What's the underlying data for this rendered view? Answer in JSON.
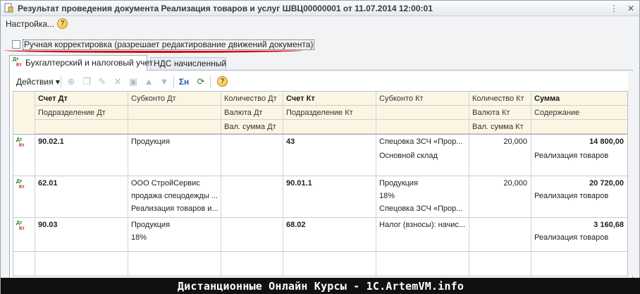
{
  "window": {
    "title": "Результат проведения документа Реализация товаров и услуг ШВЦ00000001 от 11.07.2014 12:00:01",
    "icon": "document-icon"
  },
  "menu": {
    "settings_label": "Настройка...",
    "help_label": "?"
  },
  "manual_edit": {
    "label": "Ручная корректировка (разрешает редактирование движений документа)",
    "checked": false
  },
  "tabs": [
    {
      "label": "Бухгалтерский и налоговый учет",
      "active": true,
      "icon_top": "Дт",
      "icon_bottom": "Кт"
    },
    {
      "label": "НДС начисленный",
      "active": false
    }
  ],
  "toolbar": {
    "actions_label": "Действия",
    "sum_label": "Σн",
    "help_label": "?"
  },
  "columns": {
    "row1": [
      "Счет Дт",
      "Субконто Дт",
      "Количество Дт",
      "Счет Кт",
      "Субконто Кт",
      "Количество Кт",
      "Сумма"
    ],
    "row2": [
      "Подразделение Дт",
      "",
      "Валюта Дт",
      "Подразделение Кт",
      "",
      "Валюта Кт",
      "Содержание"
    ],
    "row3": [
      "",
      "",
      "Вал. сумма Дт",
      "",
      "",
      "Вал. сумма Кт",
      ""
    ]
  },
  "rows": [
    {
      "icon_top": "Дт",
      "icon_bottom": "Кт",
      "acct_dt": "90.02.1",
      "sub_dt": [
        "Продукция"
      ],
      "qty_dt": "",
      "acct_kt": "43",
      "sub_kt": [
        "Спецовка ЗСЧ «Прор...",
        "Основной склад"
      ],
      "qty_kt": "20,000",
      "sum": "14 800,00",
      "content": "Реализация товаров"
    },
    {
      "icon_top": "Дт",
      "icon_bottom": "Кт",
      "acct_dt": "62.01",
      "sub_dt": [
        "ООО СтройСервис",
        "продажа спецодежды ...",
        "Реализация товаров и..."
      ],
      "qty_dt": "",
      "acct_kt": "90.01.1",
      "sub_kt": [
        "Продукция",
        "18%",
        "Спецовка ЗСЧ «Прор..."
      ],
      "qty_kt": "20,000",
      "sum": "20 720,00",
      "content": "Реализация товаров"
    },
    {
      "icon_top": "Дт",
      "icon_bottom": "Кт",
      "acct_dt": "90.03",
      "sub_dt": [
        "Продукция",
        "18%"
      ],
      "qty_dt": "",
      "acct_kt": "68.02",
      "sub_kt": [
        "Налог (взносы): начис..."
      ],
      "qty_kt": "",
      "sum": "3 160,68",
      "content": "Реализация товаров"
    }
  ],
  "footer": {
    "text": "Дистанционные Онлайн Курсы - 1C.ArtemVM.info"
  },
  "colors": {
    "header_bg": "#fbf6e4",
    "annotation_red": "#d01010",
    "footer_bg": "#111111"
  }
}
